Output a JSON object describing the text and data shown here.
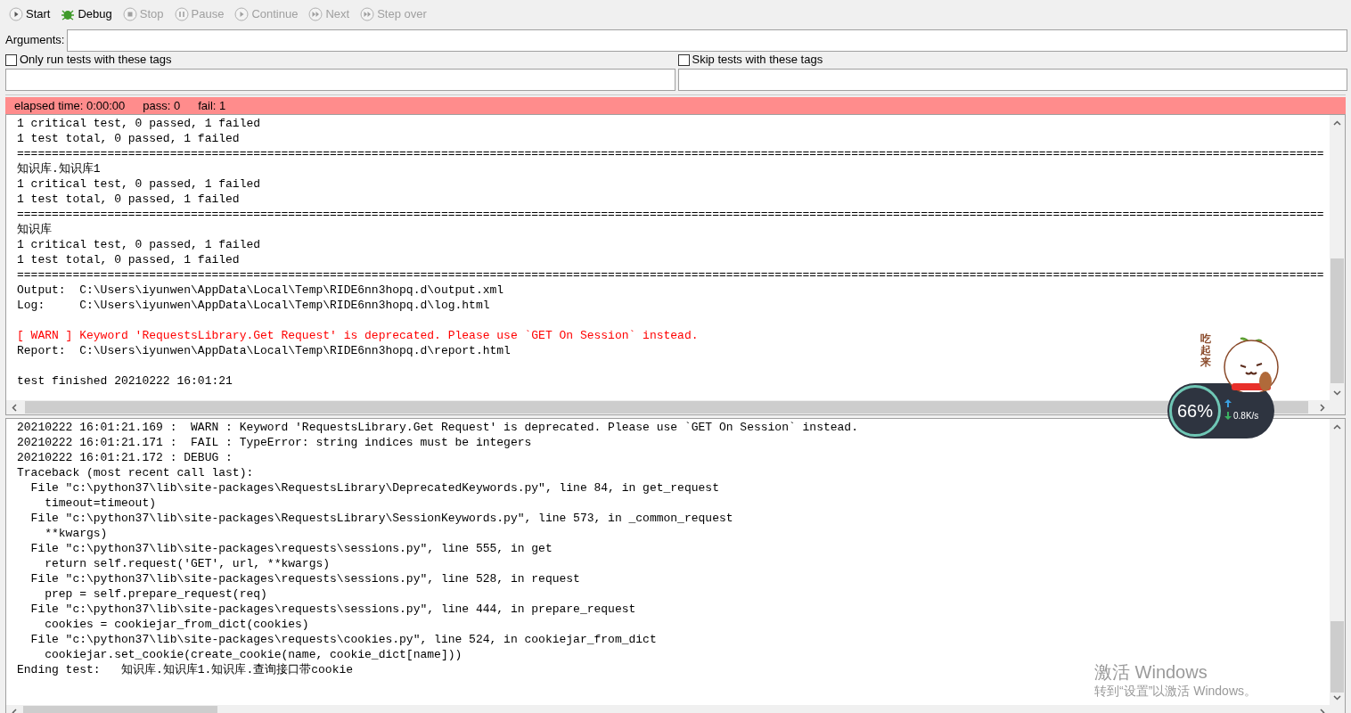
{
  "toolbar": [
    {
      "label": "Start",
      "kind": "play",
      "disabled": false
    },
    {
      "label": "Debug",
      "kind": "debug",
      "disabled": false
    },
    {
      "label": "Stop",
      "kind": "stop",
      "disabled": true
    },
    {
      "label": "Pause",
      "kind": "pause",
      "disabled": true
    },
    {
      "label": "Continue",
      "kind": "play",
      "disabled": true
    },
    {
      "label": "Next",
      "kind": "next",
      "disabled": true
    },
    {
      "label": "Step over",
      "kind": "next",
      "disabled": true
    }
  ],
  "arguments": {
    "label": "Arguments:"
  },
  "tag_filters": [
    {
      "label": "Only run tests with these tags",
      "checked": false
    },
    {
      "label": "Skip tests with these tags",
      "checked": false
    }
  ],
  "status_bar": {
    "elapsed": "elapsed time: 0:00:00",
    "pass": "pass: 0",
    "fail": "fail: 1"
  },
  "output": [
    {
      "kind": "text",
      "text": "1 critical test, 0 passed, 1 failed"
    },
    {
      "kind": "text",
      "text": "1 test total, 0 passed, 1 failed"
    },
    {
      "kind": "rule",
      "text": "============================================================================================================================================================================================"
    },
    {
      "kind": "text",
      "text": "知识库.知识库1"
    },
    {
      "kind": "text",
      "text": "1 critical test, 0 passed, 1 failed"
    },
    {
      "kind": "text",
      "text": "1 test total, 0 passed, 1 failed"
    },
    {
      "kind": "rule",
      "text": "============================================================================================================================================================================================"
    },
    {
      "kind": "text",
      "text": "知识库"
    },
    {
      "kind": "text",
      "text": "1 critical test, 0 passed, 1 failed"
    },
    {
      "kind": "text",
      "text": "1 test total, 0 passed, 1 failed"
    },
    {
      "kind": "rule",
      "text": "============================================================================================================================================================================================"
    },
    {
      "kind": "text",
      "text": "Output:  C:\\Users\\iyunwen\\AppData\\Local\\Temp\\RIDE6nn3hopq.d\\output.xml"
    },
    {
      "kind": "text",
      "text": "Log:     C:\\Users\\iyunwen\\AppData\\Local\\Temp\\RIDE6nn3hopq.d\\log.html"
    },
    {
      "kind": "blank"
    },
    {
      "kind": "warn",
      "text": "[ WARN ] Keyword 'RequestsLibrary.Get Request' is deprecated. Please use `GET On Session` instead."
    },
    {
      "kind": "text",
      "text": "Report:  C:\\Users\\iyunwen\\AppData\\Local\\Temp\\RIDE6nn3hopq.d\\report.html"
    },
    {
      "kind": "blank"
    },
    {
      "kind": "text",
      "text": "test finished 20210222 16:01:21"
    }
  ],
  "log": [
    {
      "kind": "text",
      "text": "20210222 16:01:21.169 :  WARN : Keyword 'RequestsLibrary.Get Request' is deprecated. Please use `GET On Session` instead."
    },
    {
      "kind": "text",
      "text": "20210222 16:01:21.171 :  FAIL : TypeError: string indices must be integers"
    },
    {
      "kind": "text",
      "text": "20210222 16:01:21.172 : DEBUG :"
    },
    {
      "kind": "text",
      "text": "Traceback (most recent call last):"
    },
    {
      "kind": "text",
      "text": "  File \"c:\\python37\\lib\\site-packages\\RequestsLibrary\\DeprecatedKeywords.py\", line 84, in get_request"
    },
    {
      "kind": "text",
      "text": "    timeout=timeout)"
    },
    {
      "kind": "text",
      "text": "  File \"c:\\python37\\lib\\site-packages\\RequestsLibrary\\SessionKeywords.py\", line 573, in _common_request"
    },
    {
      "kind": "text",
      "text": "    **kwargs)"
    },
    {
      "kind": "text",
      "text": "  File \"c:\\python37\\lib\\site-packages\\requests\\sessions.py\", line 555, in get"
    },
    {
      "kind": "text",
      "text": "    return self.request('GET', url, **kwargs)"
    },
    {
      "kind": "text",
      "text": "  File \"c:\\python37\\lib\\site-packages\\requests\\sessions.py\", line 528, in request"
    },
    {
      "kind": "text",
      "text": "    prep = self.prepare_request(req)"
    },
    {
      "kind": "text",
      "text": "  File \"c:\\python37\\lib\\site-packages\\requests\\sessions.py\", line 444, in prepare_request"
    },
    {
      "kind": "text",
      "text": "    cookies = cookiejar_from_dict(cookies)"
    },
    {
      "kind": "text",
      "text": "  File \"c:\\python37\\lib\\site-packages\\requests\\cookies.py\", line 524, in cookiejar_from_dict"
    },
    {
      "kind": "text",
      "text": "    cookiejar.set_cookie(create_cookie(name, cookie_dict[name]))"
    },
    {
      "kind": "text",
      "text": "Ending test:   知识库.知识库1.知识库.查询接口带cookie"
    }
  ],
  "widget": {
    "sticker_text": "吃起来",
    "percent": "66%",
    "speed": "0.8K/s"
  },
  "activation": {
    "title": "激活 Windows",
    "subtitle": "转到“设置”以激活 Windows。"
  }
}
